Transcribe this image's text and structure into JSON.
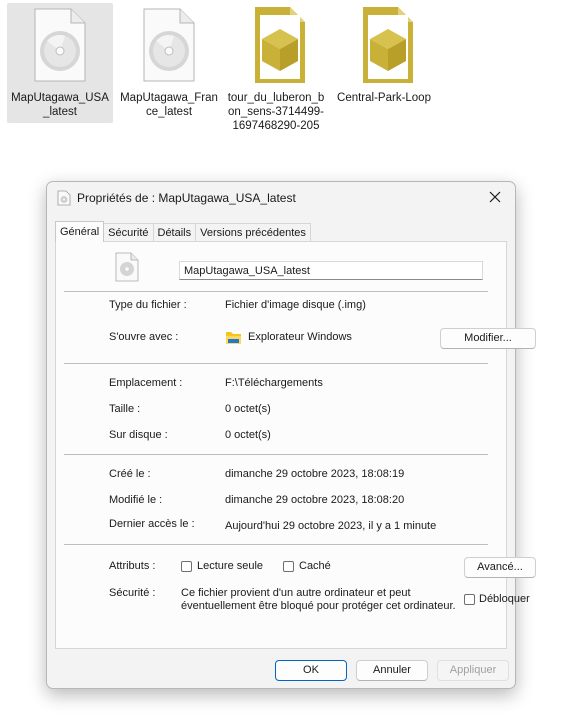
{
  "desktop": {
    "files": [
      {
        "label": "MapUtagawa_USA_latest",
        "icon": "disc-image-icon",
        "selected": true
      },
      {
        "label": "MapUtagawa_France_latest",
        "icon": "disc-image-icon",
        "selected": false
      },
      {
        "label": "tour_du_luberon_bon_sens-3714499-1697468290-205",
        "icon": "package-file-icon",
        "selected": false
      },
      {
        "label": "Central-Park-Loop",
        "icon": "package-file-icon",
        "selected": false
      }
    ]
  },
  "dialog": {
    "title": "Propriétés de : MapUtagawa_USA_latest",
    "tabs": [
      "Général",
      "Sécurité",
      "Détails",
      "Versions précédentes"
    ],
    "active_tab": "Général",
    "file_name": "MapUtagawa_USA_latest",
    "type_label": "Type du fichier :",
    "type_value": "Fichier d'image disque (.img)",
    "opens_with_label": "S'ouvre avec :",
    "opens_with_value": "Explorateur Windows",
    "modify_button": "Modifier...",
    "location_label": "Emplacement :",
    "location_value": "F:\\Téléchargements",
    "size_label": "Taille :",
    "size_value": "0 octet(s)",
    "disk_size_label": "Sur disque :",
    "disk_size_value": "0 octet(s)",
    "created_label": "Créé le :",
    "created_value": "dimanche 29 octobre 2023, 18:08:19",
    "modified_label": "Modifié le :",
    "modified_value": "dimanche 29 octobre 2023, 18:08:20",
    "accessed_label": "Dernier accès le :",
    "accessed_value": "Aujourd'hui 29 octobre 2023, il y a 1 minute",
    "attributes_label": "Attributs :",
    "readonly_label": "Lecture seule",
    "hidden_label": "Caché",
    "advanced_button": "Avancé...",
    "security_label": "Sécurité :",
    "security_line1": "Ce fichier provient d'un autre ordinateur et peut",
    "security_line2": "éventuellement être bloqué pour protéger cet ordinateur.",
    "unblock_label": "Débloquer",
    "ok_button": "OK",
    "cancel_button": "Annuler",
    "apply_button": "Appliquer"
  },
  "colors": {
    "package_gold": "#c9b037",
    "accent": "#0067c0",
    "folder_yellow": "#f5c518"
  }
}
